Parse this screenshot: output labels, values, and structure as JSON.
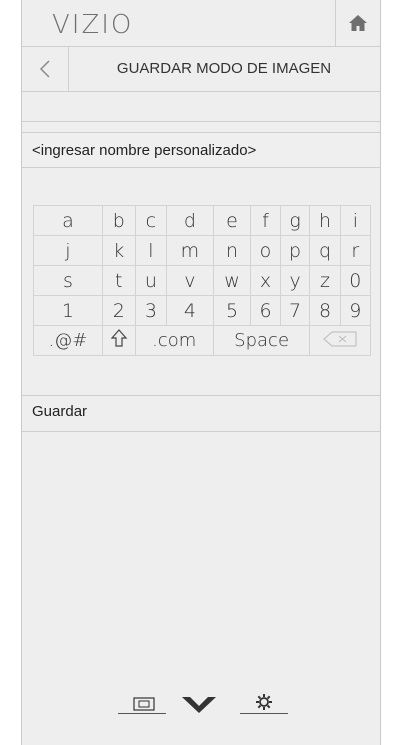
{
  "header": {
    "logo": "VIZIO",
    "home_icon": "home-icon"
  },
  "titlebar": {
    "back_icon": "back-arrow-icon",
    "title": "GUARDAR MODO DE IMAGEN"
  },
  "name_field": {
    "placeholder": "<ingresar nombre personalizado>"
  },
  "keyboard": {
    "rows": [
      [
        "a",
        "b",
        "c",
        "d",
        "e",
        "f",
        "g",
        "h",
        "i"
      ],
      [
        "j",
        "k",
        "l",
        "m",
        "n",
        "o",
        "p",
        "q",
        "r"
      ],
      [
        "s",
        "t",
        "u",
        "v",
        "w",
        "x",
        "y",
        "z",
        "0"
      ],
      [
        "1",
        "2",
        "3",
        "4",
        "5",
        "6",
        "7",
        "8",
        "9"
      ]
    ],
    "special": {
      "symbols": ".@#",
      "shift_icon": "shift-arrow-icon",
      "dotcom": ".com",
      "space": "Space",
      "backspace_icon": "backspace-icon"
    }
  },
  "save_button": {
    "label": "Guardar"
  },
  "bottom_bar": {
    "icons": [
      "input-icon",
      "vizio-v-icon",
      "settings-gear-icon"
    ]
  }
}
